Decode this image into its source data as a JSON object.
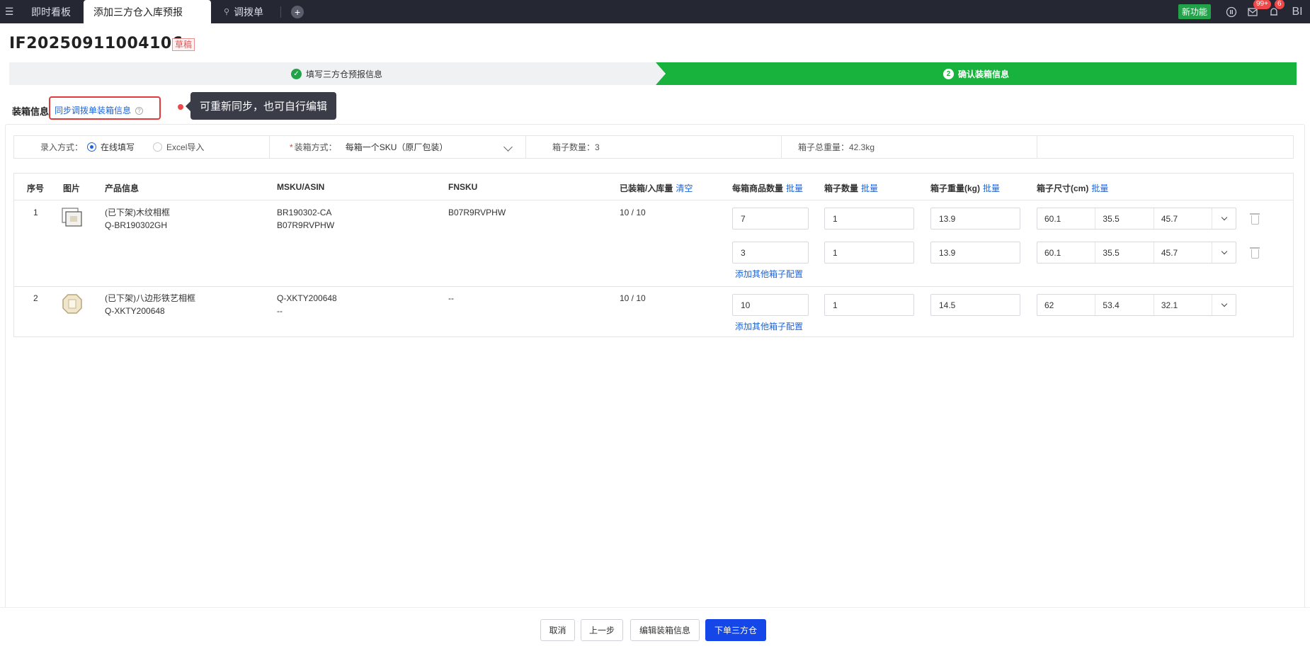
{
  "tabs": [
    {
      "label": "即时看板"
    },
    {
      "label": "添加三方仓入库预报"
    },
    {
      "label": "调拨单"
    }
  ],
  "topbar": {
    "new_feature": "新功能",
    "badge_messages": "99+",
    "badge_notices": "6",
    "bi_label": "BI"
  },
  "header": {
    "doc_no": "IF20250911004106",
    "status": "草稿"
  },
  "steps": [
    {
      "label": "填写三方仓预报信息",
      "state": "done"
    },
    {
      "label": "确认装箱信息",
      "num": "2",
      "state": "active"
    }
  ],
  "section": {
    "title": "装箱信息",
    "sync_link": "同步调拨单装箱信息",
    "tooltip": "可重新同步，也可自行编辑"
  },
  "form": {
    "entry_label": "录入方式：",
    "entry_online": "在线填写",
    "entry_excel": "Excel导入",
    "packing_label": "装箱方式：",
    "packing_value": "每箱一个SKU（原厂包装）",
    "box_count": "箱子数量：3",
    "total_weight": "箱子总重量：42.3kg"
  },
  "table": {
    "headers": {
      "seq": "序号",
      "image": "图片",
      "product": "产品信息",
      "msku": "MSKU/ASIN",
      "fnsku": "FNSKU",
      "packed": "已装箱/入库量",
      "clear": "清空",
      "per_box": "每箱商品数量",
      "box_qty": "箱子数量",
      "weight": "箱子重量(kg)",
      "size": "箱子尺寸(cm)",
      "batch": "批量"
    },
    "rows": [
      {
        "seq": "1",
        "name": "(已下架)木纹相框",
        "sku": "Q-BR190302GH",
        "msku": "BR190302-CA",
        "asin": "B07R9RVPHW",
        "fnsku": "B07R9RVPHW",
        "packed": "10 / 10",
        "boxes": [
          {
            "per_box": "7",
            "qty": "1",
            "weight": "13.9",
            "l": "60.1",
            "w": "35.5",
            "h": "45.7"
          },
          {
            "per_box": "3",
            "qty": "1",
            "weight": "13.9",
            "l": "60.1",
            "w": "35.5",
            "h": "45.7"
          }
        ],
        "add_link": "添加其他箱子配置"
      },
      {
        "seq": "2",
        "name": "(已下架)八边形铁艺相框",
        "sku": "Q-XKTY200648",
        "msku": "Q-XKTY200648",
        "asin": "--",
        "fnsku": "--",
        "packed": "10 / 10",
        "boxes": [
          {
            "per_box": "10",
            "qty": "1",
            "weight": "14.5",
            "l": "62",
            "w": "53.4",
            "h": "32.1"
          }
        ],
        "add_link": "添加其他箱子配置"
      }
    ]
  },
  "footer": {
    "cancel": "取消",
    "prev": "上一步",
    "edit": "编辑装箱信息",
    "submit": "下单三方仓"
  }
}
